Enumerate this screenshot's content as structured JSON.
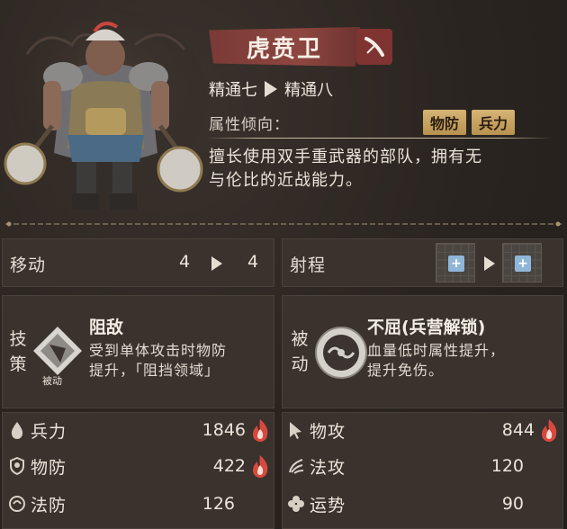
{
  "unit": {
    "name": "虎贲卫",
    "class_icon": "sword-icon",
    "rank_from": "精通七",
    "rank_to": "精通八",
    "attribute_label": "属性倾向：",
    "attribute_tags": [
      "物防",
      "兵力"
    ],
    "description_line1": "擅长使用双手重武器的部队，拥有无",
    "description_line2": "与伦比的近战能力。"
  },
  "move": {
    "label": "移动",
    "from": "4",
    "to": "4"
  },
  "range": {
    "label": "射程"
  },
  "skill": {
    "vert_label_1": "技",
    "vert_label_2": "策",
    "name": "阻敌",
    "badge": "被动",
    "desc_line1": "受到单体攻击时物防",
    "desc_line2": "提升，「阻挡领域」"
  },
  "passive": {
    "vert_label_1": "被",
    "vert_label_2": "动",
    "name": "不屈(兵营解锁)",
    "desc_line1": "血量低时属性提升，",
    "desc_line2": "提升免伤。"
  },
  "stats": {
    "troops": {
      "label": "兵力",
      "value": "1846",
      "icon": "drop-icon"
    },
    "phys_atk": {
      "label": "物攻",
      "value": "844",
      "icon": "sword-cursor-icon"
    },
    "phys_def": {
      "label": "物防",
      "value": "422",
      "icon": "shield-icon"
    },
    "mag_atk": {
      "label": "法攻",
      "value": "120",
      "icon": "magic-claw-icon"
    },
    "mag_def": {
      "label": "法防",
      "value": "126",
      "icon": "orb-shield-icon"
    },
    "luck": {
      "label": "运势",
      "value": "90",
      "icon": "clover-icon"
    }
  },
  "colors": {
    "banner": "#8e4640",
    "tag": "#c9a462",
    "flame": "#d9483e",
    "panel": "#3a322d"
  }
}
